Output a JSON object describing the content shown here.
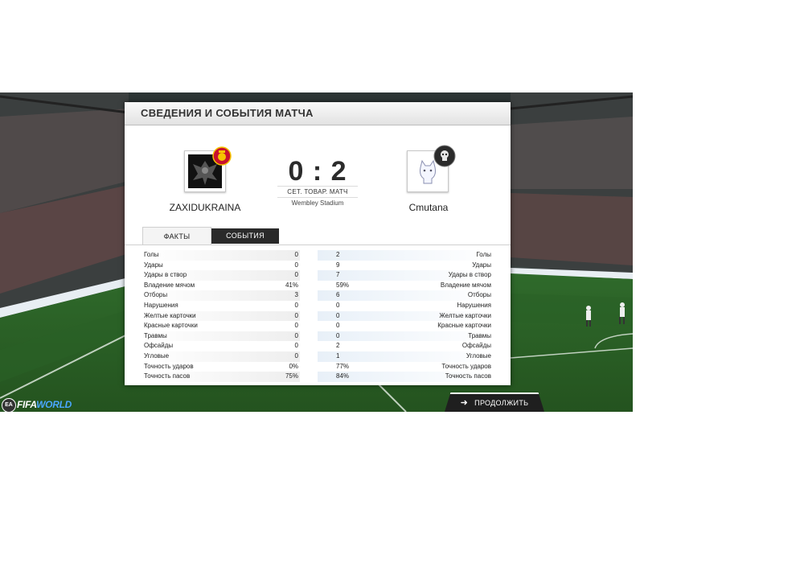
{
  "panel": {
    "title": "СВЕДЕНИЯ И СОБЫТИЯ МАТЧА"
  },
  "match": {
    "home_team": "ZAXIDUKRAINA",
    "away_team": "Cmutana",
    "score": "0 : 2",
    "match_type": "СЕТ. ТОВАР. МАТЧ",
    "stadium": "Wembley Stadium"
  },
  "tabs": [
    {
      "label": "ФАКТЫ",
      "active": true
    },
    {
      "label": "СОБЫТИЯ",
      "active": false
    }
  ],
  "stats": [
    {
      "label": "Голы",
      "home": "0",
      "away": "2"
    },
    {
      "label": "Удары",
      "home": "0",
      "away": "9"
    },
    {
      "label": "Удары в створ",
      "home": "0",
      "away": "7"
    },
    {
      "label": "Владение мячом",
      "home": "41%",
      "away": "59%"
    },
    {
      "label": "Отборы",
      "home": "3",
      "away": "6"
    },
    {
      "label": "Нарушения",
      "home": "0",
      "away": "0"
    },
    {
      "label": "Желтые карточки",
      "home": "0",
      "away": "0"
    },
    {
      "label": "Красные карточки",
      "home": "0",
      "away": "0"
    },
    {
      "label": "Травмы",
      "home": "0",
      "away": "0"
    },
    {
      "label": "Офсайды",
      "home": "0",
      "away": "2"
    },
    {
      "label": "Угловые",
      "home": "0",
      "away": "1"
    },
    {
      "label": "Точность ударов",
      "home": "0%",
      "away": "77%"
    },
    {
      "label": "Точность пасов",
      "home": "75%",
      "away": "84%"
    }
  ],
  "continue_button": {
    "label": "ПРОДОЛЖИТЬ",
    "icon": "arrow-right-icon"
  },
  "logo": {
    "badge": "EA",
    "text_part1": "FIFA",
    "text_part2": "WORLD"
  },
  "colors": {
    "panel_bg": "#ffffff",
    "button_bg": "#1f1f1f",
    "logo_accent": "#4aa6ff",
    "home_crest_badge": "#c8102e",
    "away_crest_badge": "#2b2b2b"
  }
}
